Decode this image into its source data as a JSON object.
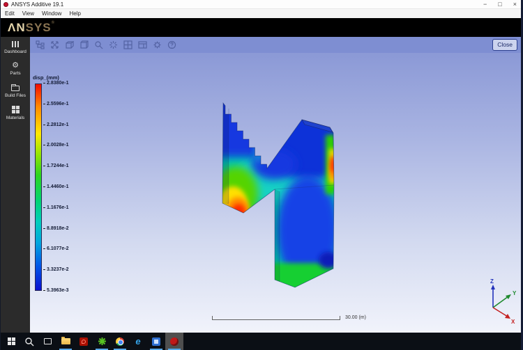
{
  "window": {
    "title": "ANSYS Additive 19.1",
    "minimize": "−",
    "maximize": "□",
    "close": "×"
  },
  "menu": {
    "items": [
      "Edit",
      "View",
      "Window",
      "Help"
    ]
  },
  "brand": {
    "part1": "ΛN",
    "part2": "SYS",
    "reg": "®"
  },
  "toolbar": {
    "close_label": "Close",
    "icons": [
      "model-tree",
      "fit-view",
      "isometric-view",
      "bounding-box",
      "zoom",
      "refresh-view",
      "grid-layout",
      "window-layout",
      "settings",
      "help"
    ]
  },
  "sidebar": {
    "items": [
      {
        "label": "Dashboard",
        "icon": "columns-icon"
      },
      {
        "label": "Parts",
        "icon": "gear-icon"
      },
      {
        "label": "Build Files",
        "icon": "folder-icon"
      },
      {
        "label": "Materials",
        "icon": "grid-icon"
      }
    ]
  },
  "legend": {
    "title": "disp_(mm)",
    "labels": [
      "2.8380e-1",
      "2.5596e-1",
      "2.2812e-1",
      "2.0028e-1",
      "1.7244e-1",
      "1.4460e-1",
      "1.1676e-1",
      "8.8918e-2",
      "6.1077e-2",
      "3.3237e-2",
      "5.3963e-3"
    ],
    "max_color": "#ff0000",
    "min_color": "#0b10cf"
  },
  "scale_bar": {
    "label": "30.00 (m)"
  },
  "triad": {
    "x": "X",
    "y": "Y",
    "z": "Z",
    "x_color": "#c42222",
    "y_color": "#1f8a2f",
    "z_color": "#2433bb"
  },
  "taskbar": {
    "items": [
      {
        "name": "start"
      },
      {
        "name": "search"
      },
      {
        "name": "task-view"
      },
      {
        "name": "file-explorer",
        "running": true
      },
      {
        "name": "acrobat"
      },
      {
        "name": "green-app",
        "running": true
      },
      {
        "name": "chrome",
        "running": true
      },
      {
        "name": "internet-explorer",
        "glyph": "e"
      },
      {
        "name": "blue-app",
        "running": true
      },
      {
        "name": "ansys-additive",
        "running": true,
        "active": true
      }
    ]
  },
  "colors": {
    "accent_red": "#c8102e",
    "toolbar": "#7e8ed2",
    "sidebar": "#2b2b2b",
    "taskbar": "#0b0f15"
  }
}
